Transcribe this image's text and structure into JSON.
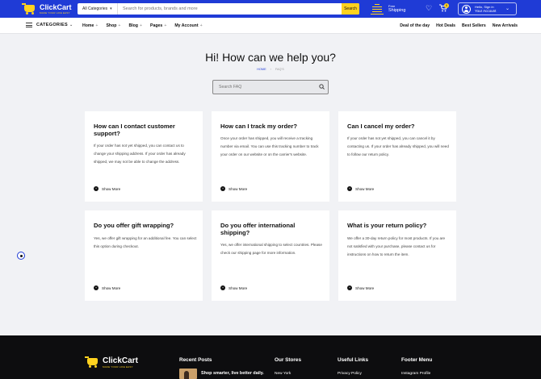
{
  "header": {
    "logo_name": "ClickCart",
    "logo_tagline": "MAKE YOUR LIFE EASY",
    "category_select": "All Categories",
    "search_placeholder": "Search for products, brands and more",
    "search_button": "Search",
    "shipping_line1": "Free",
    "shipping_line2": "Shipping",
    "cart_count": "0",
    "account_line1": "Hello, Sign in",
    "account_line2": "Your Account"
  },
  "nav": {
    "categories_label": "CATEGORIES",
    "menu": [
      {
        "label": "Home",
        "plus": "+"
      },
      {
        "label": "Shop",
        "plus": "+"
      },
      {
        "label": "Blog",
        "plus": "+"
      },
      {
        "label": "Pages",
        "plus": "+"
      },
      {
        "label": "My Account",
        "plus": "+"
      }
    ],
    "quick_links": [
      "Deal of the day",
      "Hot Deals",
      "Best Sellers",
      "New Arrivals"
    ]
  },
  "hero": {
    "title": "Hi! How can we help you?",
    "breadcrumb_home": "HOME",
    "breadcrumb_sep": "›",
    "breadcrumb_current": "FAQ'S",
    "faq_search_placeholder": "Search FAQ"
  },
  "faqs": [
    {
      "question": "How can I contact customer support?",
      "answer": "If your order has not yet shipped, you can contact us to change your shipping address. If your order has already shipped, we may not be able to change the address.",
      "more": "Show More"
    },
    {
      "question": "How can I track my order?",
      "answer": "Once your order has shipped, you will receive a tracking number via email. You can use this tracking number to track your order on our website or on the carrier's website.",
      "more": "Show More"
    },
    {
      "question": "Can I cancel my order?",
      "answer": "If your order has not yet shipped, you can cancel it by contacting us. If your order has already shipped, you will need to follow our return policy.",
      "more": "Show More"
    },
    {
      "question": "Do you offer gift wrapping?",
      "answer": "Yes, we offer gift wrapping for an additional fee. You can select this option during checkout.",
      "more": "Show More"
    },
    {
      "question": "Do you offer international shipping?",
      "answer": "Yes, we offer international shipping to select countries. Please check our shipping page for more information.",
      "more": "Show More"
    },
    {
      "question": "What is your return policy?",
      "answer": "We offer a 30-day return policy for most products. If you are not satisfied with your purchase, please contact us for instructions on how to return the item.",
      "more": "Show More"
    }
  ],
  "footer": {
    "logo_name": "ClickCart",
    "logo_tagline": "MAKE YOUR LIFE EASY",
    "recent_posts_title": "Recent Posts",
    "recent_post_1": "Shop smarter, live better daily.",
    "our_stores_title": "Our Stores",
    "store_1": "New York",
    "useful_links_title": "Useful Links",
    "useful_link_1": "Privacy Policy",
    "footer_menu_title": "Footer Menu",
    "footer_menu_1": "Instagram Profile"
  },
  "colors": {
    "brand_blue": "#1f3bd6",
    "accent_yellow": "#ffd21f",
    "footer_bg": "#0d0d0f"
  }
}
